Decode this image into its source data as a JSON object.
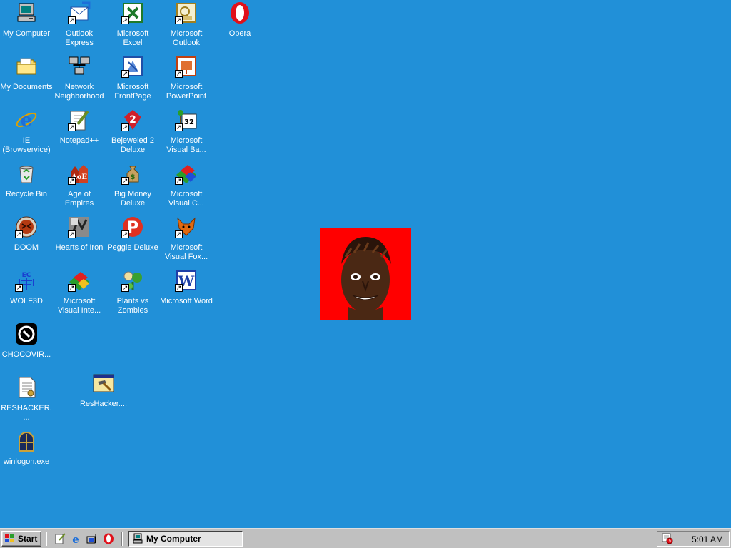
{
  "desktop": {
    "icons": [
      {
        "id": "my-computer",
        "label": "My Computer",
        "icon": "computer-icon",
        "shortcut": false
      },
      {
        "id": "outlook-express",
        "label": "Outlook Express",
        "icon": "outlook-express-icon",
        "shortcut": true
      },
      {
        "id": "microsoft-excel",
        "label": "Microsoft Excel",
        "icon": "excel-icon",
        "shortcut": true
      },
      {
        "id": "microsoft-outlook",
        "label": "Microsoft Outlook",
        "icon": "outlook-icon",
        "shortcut": true
      },
      {
        "id": "opera",
        "label": "Opera",
        "icon": "opera-icon",
        "shortcut": false
      },
      {
        "id": "my-documents",
        "label": "My Documents",
        "icon": "folder-icon",
        "shortcut": false
      },
      {
        "id": "network-neighborhood",
        "label": "Network Neighborhood",
        "icon": "network-icon",
        "shortcut": false
      },
      {
        "id": "microsoft-frontpage",
        "label": "Microsoft FrontPage",
        "icon": "frontpage-icon",
        "shortcut": true
      },
      {
        "id": "microsoft-powerpoint",
        "label": "Microsoft PowerPoint",
        "icon": "powerpoint-icon",
        "shortcut": true
      },
      {
        "id": "ie",
        "label": "IE (Browservice)",
        "icon": "internet-explorer-icon",
        "shortcut": false
      },
      {
        "id": "notepad-plus-plus",
        "label": "Notepad++",
        "icon": "notepad-icon",
        "shortcut": true
      },
      {
        "id": "bejeweled-2",
        "label": "Bejeweled 2 Deluxe",
        "icon": "bejeweled-icon",
        "shortcut": true
      },
      {
        "id": "microsoft-visual-basic",
        "label": "Microsoft Visual Ba...",
        "icon": "visual-basic-icon",
        "shortcut": true
      },
      {
        "id": "recycle-bin",
        "label": "Recycle Bin",
        "icon": "recycle-bin-icon",
        "shortcut": false
      },
      {
        "id": "age-of-empires",
        "label": "Age of Empires",
        "icon": "age-of-empires-icon",
        "shortcut": true
      },
      {
        "id": "big-money",
        "label": "Big Money Deluxe",
        "icon": "money-bag-icon",
        "shortcut": true
      },
      {
        "id": "microsoft-visual-c",
        "label": "Microsoft Visual C...",
        "icon": "visual-studio-icon",
        "shortcut": true
      },
      {
        "id": "doom",
        "label": "DOOM",
        "icon": "doom-icon",
        "shortcut": true
      },
      {
        "id": "hearts-of-iron",
        "label": "Hearts of Iron",
        "icon": "hearts-of-iron-icon",
        "shortcut": true
      },
      {
        "id": "peggle-deluxe",
        "label": "Peggle Deluxe",
        "icon": "peggle-icon",
        "shortcut": true
      },
      {
        "id": "microsoft-visual-foxpro",
        "label": "Microsoft Visual Fox...",
        "icon": "foxpro-icon",
        "shortcut": true
      },
      {
        "id": "wolf3d",
        "label": "WOLF3D",
        "icon": "wolf3d-icon",
        "shortcut": true
      },
      {
        "id": "microsoft-visual-interdev",
        "label": "Microsoft Visual Inte...",
        "icon": "visual-studio-icon",
        "shortcut": true
      },
      {
        "id": "plants-vs-zombies",
        "label": "Plants vs Zombies",
        "icon": "plants-vs-zombies-icon",
        "shortcut": true
      },
      {
        "id": "microsoft-word",
        "label": "Microsoft Word",
        "icon": "word-icon",
        "shortcut": true
      },
      {
        "id": "chocovir",
        "label": "CHOCOVIR...",
        "icon": "chocovir-icon",
        "shortcut": false
      },
      {
        "id": "reshacker-file",
        "label": "RESHACKER....",
        "icon": "text-file-icon",
        "shortcut": false
      },
      {
        "id": "reshacker-exe",
        "label": "ResHacker....",
        "icon": "hammer-window-icon",
        "shortcut": false
      },
      {
        "id": "winlogon",
        "label": "winlogon.exe",
        "icon": "window-arch-icon",
        "shortcut": false
      }
    ]
  },
  "taskbar": {
    "start_label": "Start",
    "task_label": "My Computer",
    "clock": "5:01 AM"
  },
  "colors": {
    "desktop": "#2190d8",
    "taskbar": "#c0c0c0",
    "photo_bg": "#ff0000"
  }
}
